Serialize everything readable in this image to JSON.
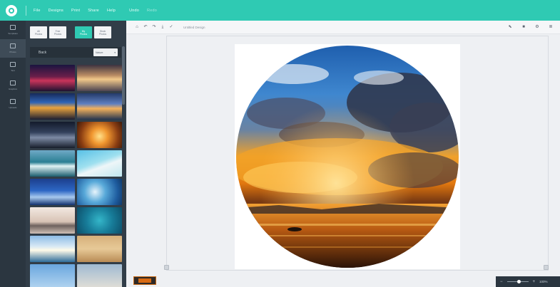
{
  "topbar": {
    "menu": [
      "File",
      "Designs",
      "Print",
      "Share",
      "Help"
    ],
    "secondary": [
      "Undo",
      "Redo"
    ]
  },
  "rail": [
    {
      "label": "Templates",
      "icon": "grid-icon"
    },
    {
      "label": "Photos",
      "icon": "image-icon"
    },
    {
      "label": "Text",
      "icon": "text-icon"
    },
    {
      "label": "Graphics",
      "icon": "shapes-icon"
    },
    {
      "label": "Uploads",
      "icon": "upload-icon"
    }
  ],
  "panel": {
    "tabs": [
      {
        "line1": "All",
        "line2": "Photos"
      },
      {
        "line1": "Free",
        "line2": "Photos"
      },
      {
        "line1": "My",
        "line2": "Photos"
      },
      {
        "line1": "Stock",
        "line2": "Photos"
      }
    ],
    "back_label": "Back",
    "filter_label": "Nature"
  },
  "toolbar": {
    "title": "Untitled Design"
  },
  "zoom": {
    "value": "100%"
  },
  "colors": {
    "accent": "#2fcab3",
    "rail": "#2b3640",
    "panel": "#313d48"
  }
}
